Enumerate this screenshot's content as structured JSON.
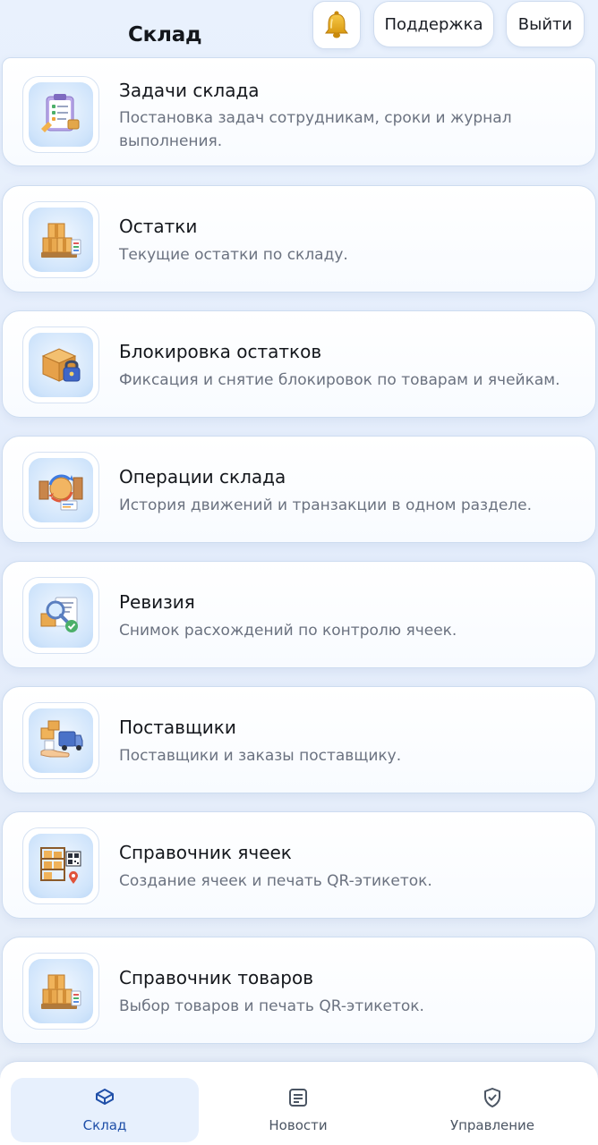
{
  "header": {
    "title": "Склад",
    "support_label": "Поддержка",
    "logout_label": "Выйти",
    "bell_icon": "bell-icon"
  },
  "cards": [
    {
      "title": "Задачи склада",
      "desc": "Постановка задач сотрудникам, сроки и журнал выполнения.",
      "icon": "clipboard-tasks-icon"
    },
    {
      "title": "Остатки",
      "desc": "Текущие остатки по складу.",
      "icon": "boxes-pallet-icon"
    },
    {
      "title": "Блокировка остатков",
      "desc": "Фиксация и снятие блокировок по товарам и ячейкам.",
      "icon": "box-lock-icon"
    },
    {
      "title": "Операции склада",
      "desc": "История движений и транзакции в одном разделе.",
      "icon": "operations-cycle-icon"
    },
    {
      "title": "Ревизия",
      "desc": "Снимок расхождений по контролю ячеек.",
      "icon": "audit-magnifier-icon"
    },
    {
      "title": "Поставщики",
      "desc": "Поставщики и заказы поставщику.",
      "icon": "supplier-truck-icon"
    },
    {
      "title": "Справочник ячеек",
      "desc": "Создание ячеек и печать QR-этикеток.",
      "icon": "shelf-qr-icon"
    },
    {
      "title": "Справочник товаров",
      "desc": "Выбор товаров и печать QR-этикеток.",
      "icon": "boxes-pallet-icon"
    }
  ],
  "nav": {
    "items": [
      {
        "label": "Склад",
        "icon": "warehouse-box-icon",
        "active": true
      },
      {
        "label": "Новости",
        "icon": "news-icon",
        "active": false
      },
      {
        "label": "Управление",
        "icon": "shield-check-icon",
        "active": false
      }
    ]
  },
  "colors": {
    "accent": "#1f4fa8",
    "active_nav_bg": "#e7f0fd",
    "card_border": "#cddcf0",
    "background": "#e6eefb"
  }
}
